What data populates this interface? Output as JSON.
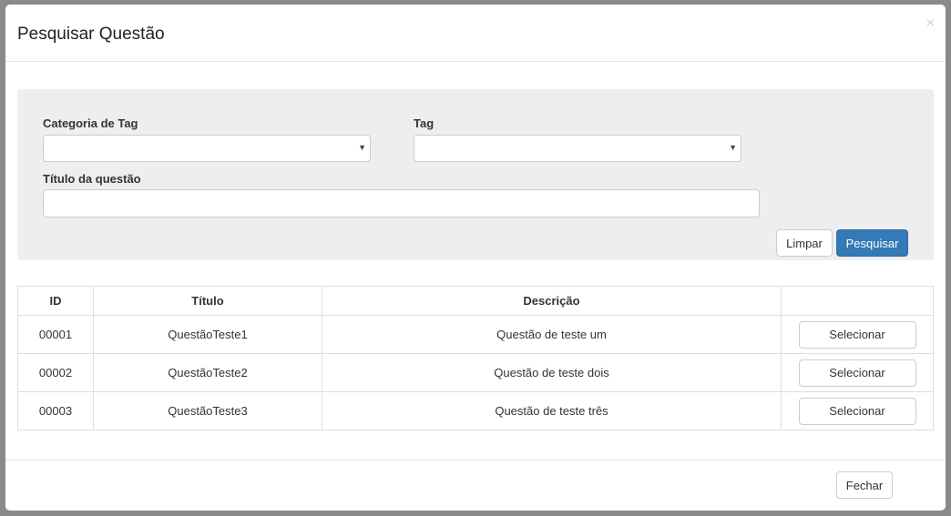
{
  "modal": {
    "title": "Pesquisar Questão",
    "close": "×"
  },
  "filters": {
    "category_label": "Categoria de Tag",
    "category_value": "",
    "tag_label": "Tag",
    "tag_value": "",
    "title_label": "Título da questão",
    "title_value": "",
    "arrow": "▼",
    "clear": "Limpar",
    "search": "Pesquisar"
  },
  "table": {
    "headers": [
      "ID",
      "Título",
      "Descrição",
      ""
    ],
    "rows": [
      {
        "id": "00001",
        "title": "QuestãoTeste1",
        "desc": "Questão de teste um",
        "action": "Selecionar"
      },
      {
        "id": "00002",
        "title": "QuestãoTeste2",
        "desc": "Questão de teste dois",
        "action": "Selecionar"
      },
      {
        "id": "00003",
        "title": "QuestãoTeste3",
        "desc": "Questão de teste três",
        "action": "Selecionar"
      }
    ]
  },
  "footer": {
    "close": "Fechar"
  }
}
